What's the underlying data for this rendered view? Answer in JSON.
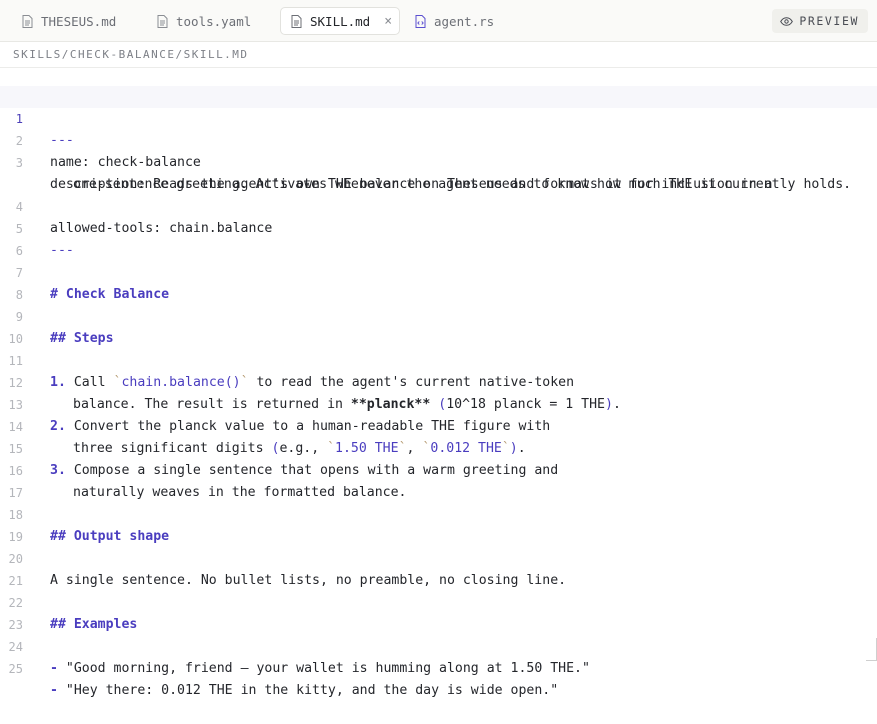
{
  "tabs": [
    {
      "label": "THESEUS.md",
      "icon": "file-icon"
    },
    {
      "label": "tools.yaml",
      "icon": "file-icon"
    },
    {
      "label": "SKILL.md",
      "icon": "file-icon",
      "active": true,
      "close": "×"
    },
    {
      "label": "agent.rs",
      "icon": "code-file-icon"
    }
  ],
  "preview_label": "PREVIEW",
  "breadcrumb": "SKILLS/CHECK-BALANCE/SKILL.MD",
  "current_line": 1,
  "lines": {
    "l1": "---",
    "l2": "name: check-balance",
    "l3": "description: Reads the agent's own THE balance on Theseus and formats it for inclusion in a",
    "l3b": "one-sentence greeting. Activates whenever the agent needs to know how much THE it currently holds.",
    "l4": "allowed-tools: chain.balance",
    "l5": "---",
    "l7": "# Check Balance",
    "l9": "## Steps",
    "l11": {
      "num": "1.",
      "pre": " Call ",
      "code": "chain.balance()",
      "post": " to read the agent's current native-token"
    },
    "l12": {
      "pre": "balance. The result is returned in ",
      "bold": "**planck**",
      "mid": " ",
      "paren_open": "(",
      "inner": "10^18 planck = 1 THE",
      "paren_close": ")",
      "post": "."
    },
    "l13": {
      "num": "2.",
      "text": " Convert the planck value to a human-readable THE figure with"
    },
    "l14": {
      "pre": "three significant digits ",
      "paren_open": "(",
      "eg": "e.g., ",
      "code1": "1.50 THE",
      "sep": ", ",
      "code2": "0.012 THE",
      "paren_close": ")",
      "post": "."
    },
    "l15": {
      "num": "3.",
      "text": " Compose a single sentence that opens with a warm greeting and"
    },
    "l16": "naturally weaves in the formatted balance.",
    "l18": "## Output shape",
    "l20": "A single sentence. No bullet lists, no preamble, no closing line.",
    "l22": "## Examples",
    "l24": {
      "dash": "-",
      "text": " \"Good morning, friend — your wallet is humming along at 1.50 THE.\""
    },
    "l25": {
      "dash": "-",
      "text": " \"Hey there: 0.012 THE in the kitty, and the day is wide open.\""
    }
  },
  "line_numbers": [
    "1",
    "2",
    "3",
    "4",
    "5",
    "6",
    "7",
    "8",
    "9",
    "10",
    "11",
    "12",
    "13",
    "14",
    "15",
    "16",
    "17",
    "18",
    "19",
    "20",
    "21",
    "22",
    "23",
    "24",
    "25"
  ],
  "colors": {
    "accent": "#4a3dbf",
    "background": "#ffffff",
    "tabbar": "#fafaf8"
  }
}
